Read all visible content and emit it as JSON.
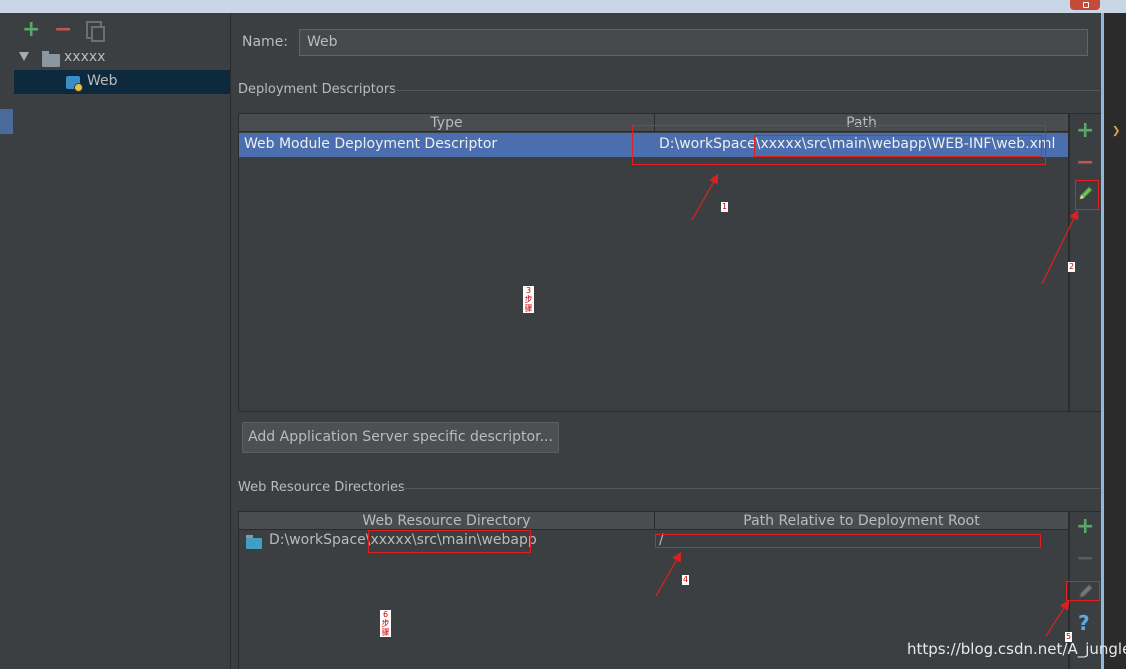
{
  "left_panel": {
    "tree": [
      {
        "label": "xxxxx",
        "icon": "folder-icon",
        "expanded": true
      },
      {
        "label": "Web",
        "icon": "web-facet-icon",
        "selected": true
      }
    ]
  },
  "name_field": {
    "label": "Name:",
    "value": "Web"
  },
  "deployment_descriptors": {
    "title": "Deployment Descriptors",
    "columns": [
      "Type",
      "Path"
    ],
    "rows": [
      {
        "type": "Web Module Deployment Descriptor",
        "path": "D:\\workSpace\\xxxxx\\src\\main\\webapp\\WEB-INF\\web.xml",
        "selected": true
      }
    ],
    "add_server_descriptor_label": "Add Application Server specific descriptor..."
  },
  "web_resource_directories": {
    "title": "Web Resource Directories",
    "columns": [
      "Web Resource Directory",
      "Path Relative to Deployment Root"
    ],
    "rows": [
      {
        "directory": "D:\\workSpace\\xxxxx\\src\\main\\webapp",
        "relative_path": "/"
      }
    ]
  },
  "toolbar_glyphs": {
    "add": "+",
    "remove": "−",
    "help": "?"
  },
  "annotations": {
    "n1": "1",
    "n2": "2",
    "n3": "3",
    "n4": "4",
    "n5": "5",
    "vert1": "3\n步\n骤",
    "vert2": "6\n步\n骤"
  },
  "watermark": "https://blog.csdn.net/A_jungle",
  "colors": {
    "background": "#3c3f41",
    "selection": "#4b6eaf",
    "tree_selection": "#0d293e",
    "add_green": "#59a869",
    "remove_red": "#c75450",
    "annotation_red": "#e02020"
  }
}
